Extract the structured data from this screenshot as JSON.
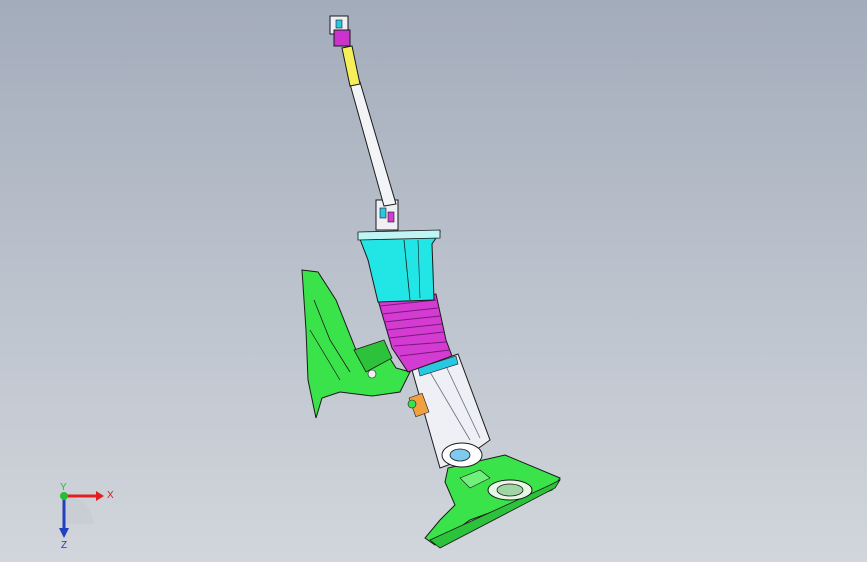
{
  "viewport": {
    "background_top": "#a3acbb",
    "background_bottom": "#d2d6dc"
  },
  "model": {
    "colors": {
      "shaft": "#f2f4f8",
      "shaft_band": "#f7ef5a",
      "joint": "#cc33cc",
      "boot_upper": "#22e6e6",
      "boot_lower": "#d33bd3",
      "housing": "#eef0f5",
      "bracket": "#3ae34a",
      "outline": "#1a1a1a",
      "accent_orange": "#f0a040",
      "accent_cyan": "#29c7e0"
    }
  },
  "triad": {
    "x_label": "X",
    "y_label": "Y",
    "z_label": "Z",
    "x_color": "#e02020",
    "y_color": "#22c030",
    "z_color": "#2040c0"
  }
}
